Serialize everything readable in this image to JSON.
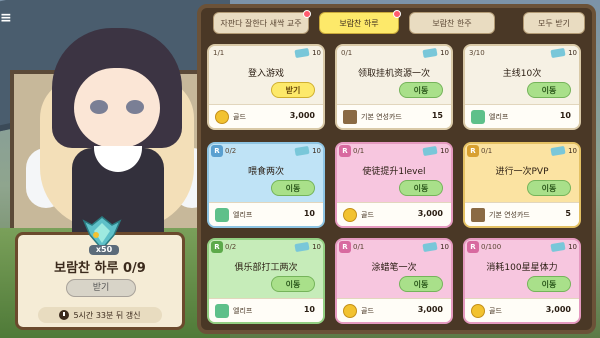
{
  "left_panel": {
    "reward_count": "x50",
    "title": "보람찬 하루 0/9",
    "receive_label": "받기",
    "timer_text": "5시간 33분 뒤 갱신"
  },
  "tabs": [
    {
      "label": "자판다 잘한다 새싹 교주",
      "active": false,
      "badge": true
    },
    {
      "label": "보람찬 하루",
      "active": true,
      "badge": true
    },
    {
      "label": "보람찬 한주",
      "active": false,
      "badge": false
    },
    {
      "label": "모두 받기",
      "active": false,
      "badge": false
    }
  ],
  "cards": [
    {
      "progress": "1/1",
      "rank": "",
      "ticket": "10",
      "task": "登入游戏",
      "action": "받기",
      "action_type": "claim",
      "reward_icon": "gold-coin-icon",
      "reward_label": "골드",
      "reward_amount": "3,000",
      "theme": "paper"
    },
    {
      "progress": "0/1",
      "rank": "",
      "ticket": "10",
      "task": "领取挂机资源一次",
      "action": "이동",
      "action_type": "go",
      "reward_icon": "card-icon",
      "reward_label": "기본 연성카드",
      "reward_amount": "15",
      "theme": "paper"
    },
    {
      "progress": "3/10",
      "rank": "",
      "ticket": "10",
      "task": "主线10次",
      "action": "이동",
      "action_type": "go",
      "reward_icon": "elixir-icon",
      "reward_label": "엘리프",
      "reward_amount": "10",
      "theme": "paper"
    },
    {
      "progress": "0/2",
      "rank": "R",
      "ticket": "10",
      "task": "喂食两次",
      "action": "이동",
      "action_type": "go",
      "reward_icon": "elixir-icon",
      "reward_label": "엘리프",
      "reward_amount": "10",
      "theme": "blue"
    },
    {
      "progress": "0/1",
      "rank": "R",
      "ticket": "10",
      "task": "使徒提升1level",
      "action": "이동",
      "action_type": "go",
      "reward_icon": "gold-coin-icon",
      "reward_label": "골드",
      "reward_amount": "3,000",
      "theme": "pink"
    },
    {
      "progress": "0/1",
      "rank": "R",
      "ticket": "10",
      "task": "进行一次PVP",
      "action": "이동",
      "action_type": "go",
      "reward_icon": "card-icon",
      "reward_label": "기본 연성카드",
      "reward_amount": "5",
      "theme": "gold"
    },
    {
      "progress": "0/2",
      "rank": "R",
      "ticket": "10",
      "task": "俱乐部打工两次",
      "action": "이동",
      "action_type": "go",
      "reward_icon": "elixir-icon",
      "reward_label": "엘리프",
      "reward_amount": "10",
      "theme": "green"
    },
    {
      "progress": "0/1",
      "rank": "R",
      "ticket": "10",
      "task": "涂蜡笔一次",
      "action": "이동",
      "action_type": "go",
      "reward_icon": "gold-coin-icon",
      "reward_label": "골드",
      "reward_amount": "3,000",
      "theme": "pink"
    },
    {
      "progress": "0/100",
      "rank": "R",
      "ticket": "10",
      "task": "消耗100星星体力",
      "action": "이동",
      "action_type": "go",
      "reward_icon": "gold-coin-icon",
      "reward_label": "골드",
      "reward_amount": "3,000",
      "theme": "pink"
    }
  ],
  "colors": {
    "active_tab": "#fde96a",
    "go_button": "#a9e08a",
    "claim_button": "#fde96a",
    "board": "#4a3826"
  }
}
